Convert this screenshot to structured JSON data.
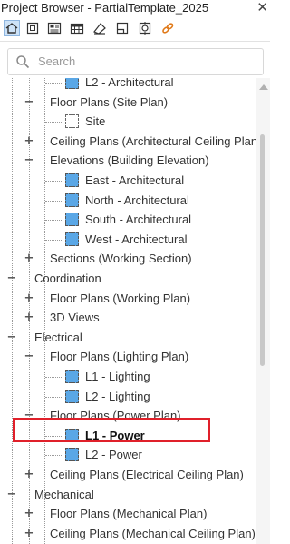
{
  "window": {
    "title": "Project Browser - PartialTemplate_2025",
    "close_glyph": "✕"
  },
  "toolbar": {
    "buttons": [
      {
        "icon": "home-icon",
        "active": true
      },
      {
        "icon": "zoom-fit-icon",
        "active": false
      },
      {
        "icon": "sheet-list-icon",
        "active": false
      },
      {
        "icon": "schedule-icon",
        "active": false
      },
      {
        "icon": "legend-icon",
        "active": false
      },
      {
        "icon": "view-template-icon",
        "active": false
      },
      {
        "icon": "filter-icon",
        "active": false
      },
      {
        "icon": "link-icon",
        "active": false
      }
    ]
  },
  "search": {
    "placeholder": "Search",
    "value": ""
  },
  "tree": {
    "items": [
      {
        "level": 3,
        "toggle": "",
        "icon": "view",
        "label": "L2 - Architectural"
      },
      {
        "level": 2,
        "toggle": "−",
        "icon": "",
        "label": "Floor Plans (Site Plan)"
      },
      {
        "level": 3,
        "toggle": "",
        "icon": "site",
        "label": "Site"
      },
      {
        "level": 2,
        "toggle": "+",
        "icon": "",
        "label": "Ceiling Plans (Architectural Ceiling Plan)"
      },
      {
        "level": 2,
        "toggle": "−",
        "icon": "",
        "label": "Elevations (Building Elevation)"
      },
      {
        "level": 3,
        "toggle": "",
        "icon": "view",
        "label": "East - Architectural"
      },
      {
        "level": 3,
        "toggle": "",
        "icon": "view",
        "label": "North - Architectural"
      },
      {
        "level": 3,
        "toggle": "",
        "icon": "view",
        "label": "South - Architectural"
      },
      {
        "level": 3,
        "toggle": "",
        "icon": "view",
        "label": "West - Architectural"
      },
      {
        "level": 2,
        "toggle": "+",
        "icon": "",
        "label": "Sections (Working Section)"
      },
      {
        "level": 1,
        "toggle": "−",
        "icon": "",
        "label": "Coordination"
      },
      {
        "level": 2,
        "toggle": "+",
        "icon": "",
        "label": "Floor Plans (Working Plan)"
      },
      {
        "level": 2,
        "toggle": "+",
        "icon": "",
        "label": "3D Views"
      },
      {
        "level": 1,
        "toggle": "−",
        "icon": "",
        "label": "Electrical"
      },
      {
        "level": 2,
        "toggle": "−",
        "icon": "",
        "label": "Floor Plans (Lighting Plan)"
      },
      {
        "level": 3,
        "toggle": "",
        "icon": "view",
        "label": "L1 - Lighting"
      },
      {
        "level": 3,
        "toggle": "",
        "icon": "view",
        "label": "L2 - Lighting"
      },
      {
        "level": 2,
        "toggle": "−",
        "icon": "",
        "label": "Floor Plans (Power Plan)"
      },
      {
        "level": 3,
        "toggle": "",
        "icon": "view",
        "label": "L1 - Power",
        "bold": true,
        "selected": true
      },
      {
        "level": 3,
        "toggle": "",
        "icon": "view",
        "label": "L2 - Power"
      },
      {
        "level": 2,
        "toggle": "+",
        "icon": "",
        "label": "Ceiling Plans (Electrical Ceiling Plan)"
      },
      {
        "level": 1,
        "toggle": "−",
        "icon": "",
        "label": "Mechanical"
      },
      {
        "level": 2,
        "toggle": "+",
        "icon": "",
        "label": "Floor Plans (Mechanical Plan)"
      },
      {
        "level": 2,
        "toggle": "+",
        "icon": "",
        "label": "Ceiling Plans (Mechanical Ceiling Plan)"
      }
    ]
  },
  "colors": {
    "highlight": "#e0202a",
    "view_icon": "#5aa7e6",
    "toolbar_active": "#cde2f7"
  }
}
